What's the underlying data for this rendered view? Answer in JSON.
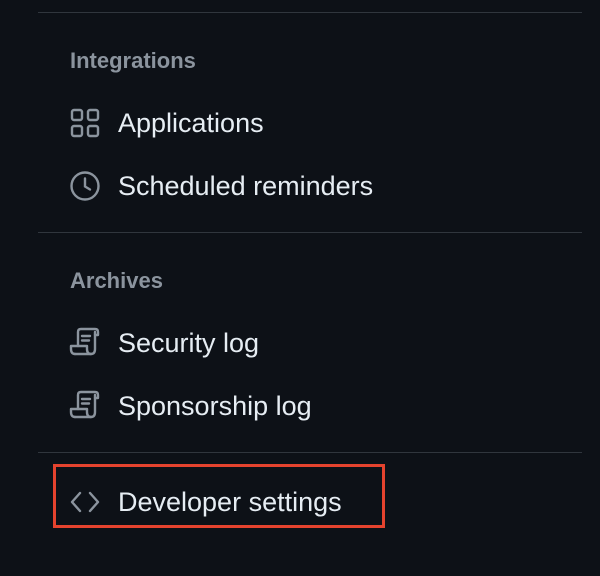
{
  "integrations": {
    "heading": "Integrations",
    "items": [
      {
        "label": "Applications",
        "icon": "apps-grid-icon"
      },
      {
        "label": "Scheduled reminders",
        "icon": "clock-icon"
      }
    ]
  },
  "archives": {
    "heading": "Archives",
    "items": [
      {
        "label": "Security log",
        "icon": "log-icon"
      },
      {
        "label": "Sponsorship log",
        "icon": "log-icon"
      }
    ]
  },
  "developer": {
    "label": "Developer settings",
    "icon": "code-icon",
    "highlight_color": "#e5432e"
  },
  "colors": {
    "background": "#0d1117",
    "divider": "#30363d",
    "heading": "#8b949e",
    "text": "#e6edf3",
    "icon": "#8b949e"
  }
}
